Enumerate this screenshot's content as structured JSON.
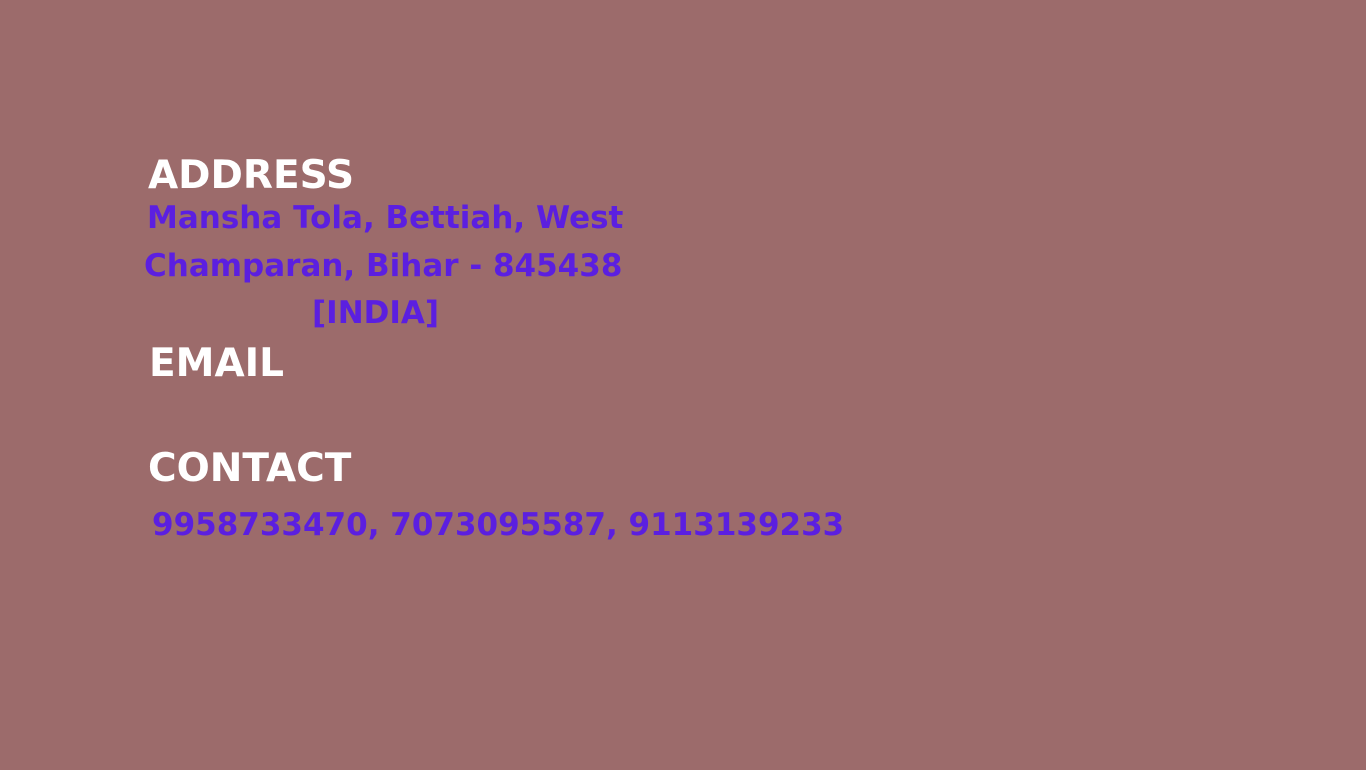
{
  "colors": {
    "background": "#9c6b6b",
    "heading": "#ffffff",
    "value": "#5b1fe0"
  },
  "address": {
    "heading": "ADDRESS",
    "line1": "Mansha Tola, Bettiah, West",
    "line2": "Champaran, Bihar - 845438",
    "line3": "[INDIA]"
  },
  "email": {
    "heading": "EMAIL"
  },
  "contact": {
    "heading": "CONTACT",
    "numbers": "9958733470, 7073095587, 9113139233"
  }
}
